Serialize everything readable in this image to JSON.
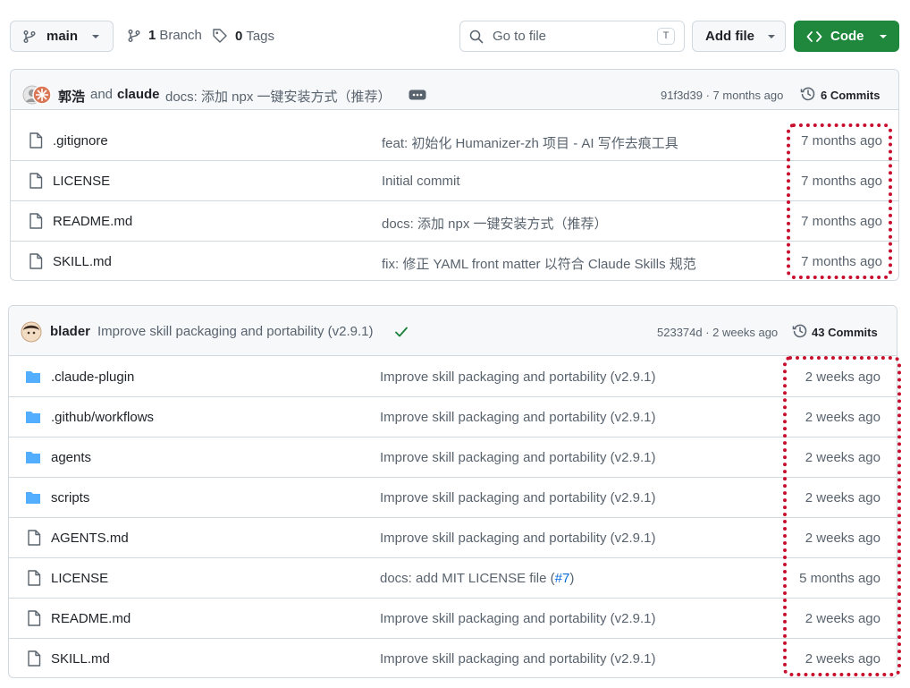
{
  "toolbar": {
    "branch_label": "main",
    "branch_count": "1",
    "branch_text": "Branch",
    "tag_count": "0",
    "tag_text": "Tags",
    "search_placeholder": "Go to file",
    "search_shortcut": "T",
    "add_file_label": "Add file",
    "code_label": "Code"
  },
  "panel1": {
    "author1": "郭浩",
    "and_text": "and",
    "author2": "claude",
    "commit_message": "docs: 添加 npx 一键安装方式（推荐）",
    "commit_meta": "91f3d39 · 7 months ago",
    "commits_count": "6 Commits",
    "rows": [
      {
        "name": ".gitignore",
        "message": "feat: 初始化 Humanizer-zh 项目 - AI 写作去痕工具",
        "age": "7 months ago"
      },
      {
        "name": "LICENSE",
        "message": "Initial commit",
        "age": "7 months ago"
      },
      {
        "name": "README.md",
        "message": "docs: 添加 npx 一键安装方式（推荐）",
        "age": "7 months ago"
      },
      {
        "name": "SKILL.md",
        "message": "fix: 修正 YAML front matter 以符合 Claude Skills 规范",
        "age": "7 months ago"
      }
    ]
  },
  "panel2": {
    "author": "blader",
    "commit_message": "Improve skill packaging and portability (v2.9.1)",
    "commit_meta": "523374d · 2 weeks ago",
    "commits_count": "43 Commits",
    "rows": [
      {
        "name": ".claude-plugin",
        "message": "Improve skill packaging and portability (v2.9.1)",
        "age": "2 weeks ago"
      },
      {
        "name": ".github/workflows",
        "message": "Improve skill packaging and portability (v2.9.1)",
        "age": "2 weeks ago"
      },
      {
        "name": "agents",
        "message": "Improve skill packaging and portability (v2.9.1)",
        "age": "2 weeks ago"
      },
      {
        "name": "scripts",
        "message": "Improve skill packaging and portability (v2.9.1)",
        "age": "2 weeks ago"
      },
      {
        "name": "AGENTS.md",
        "message": "Improve skill packaging and portability (v2.9.1)",
        "age": "2 weeks ago"
      },
      {
        "name": "LICENSE",
        "message_prefix": "docs: add MIT LICENSE file (",
        "message_link": "#7",
        "message_suffix": ")",
        "age": "5 months ago"
      },
      {
        "name": "README.md",
        "message": "Improve skill packaging and portability (v2.9.1)",
        "age": "2 weeks ago"
      },
      {
        "name": "SKILL.md",
        "message": "Improve skill packaging and portability (v2.9.1)",
        "age": "2 weeks ago"
      }
    ]
  },
  "colors": {
    "accent_green": "#1f883d",
    "link_blue": "#0969da",
    "folder_blue": "#54aeff",
    "annotation_red": "#c8102e"
  }
}
